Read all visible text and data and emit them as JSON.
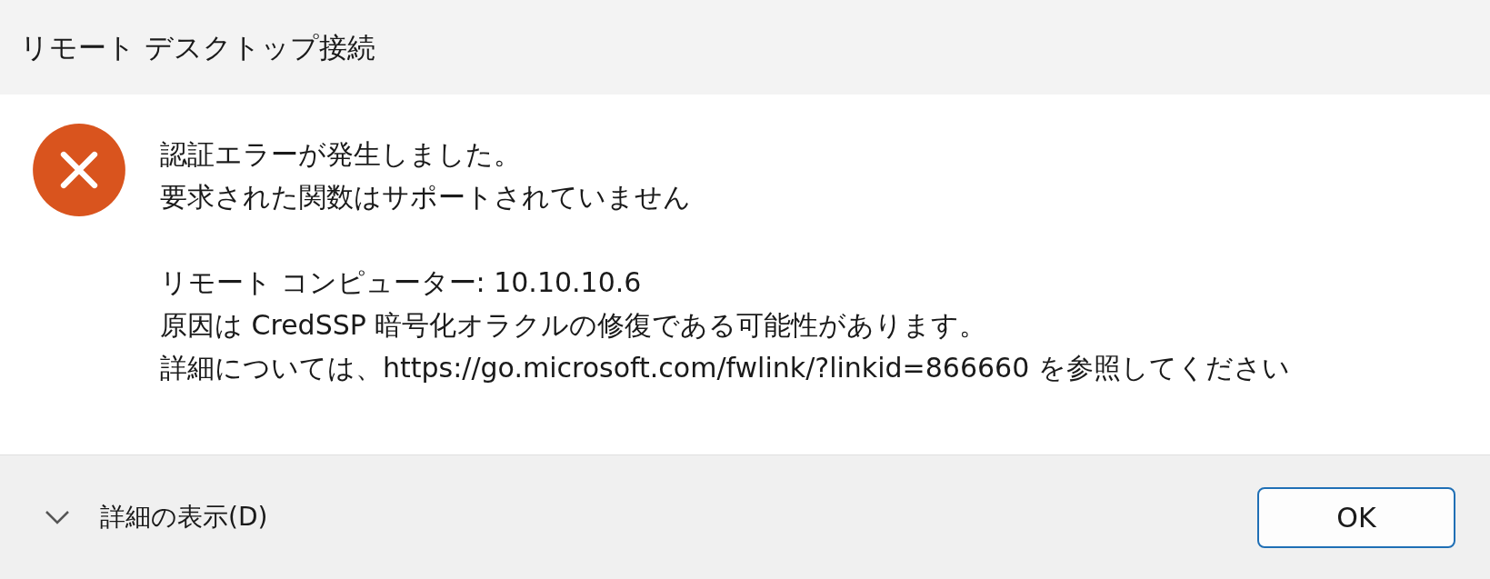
{
  "window": {
    "title": "リモート デスクトップ接続"
  },
  "message": {
    "paragraphs": [
      {
        "lines": [
          "認証エラーが発生しました。",
          "要求された関数はサポートされていません"
        ]
      },
      {
        "lines": [
          "リモート コンピューター: 10.10.10.6",
          "原因は CredSSP 暗号化オラクルの修復である可能性があります。",
          "詳細については、https://go.microsoft.com/fwlink/?linkid=866660 を参照してください"
        ]
      }
    ]
  },
  "footer": {
    "details_toggle": {
      "label": "詳細の表示(D)",
      "expanded": false
    },
    "buttons": [
      {
        "label": "OK",
        "default": true
      }
    ]
  }
}
